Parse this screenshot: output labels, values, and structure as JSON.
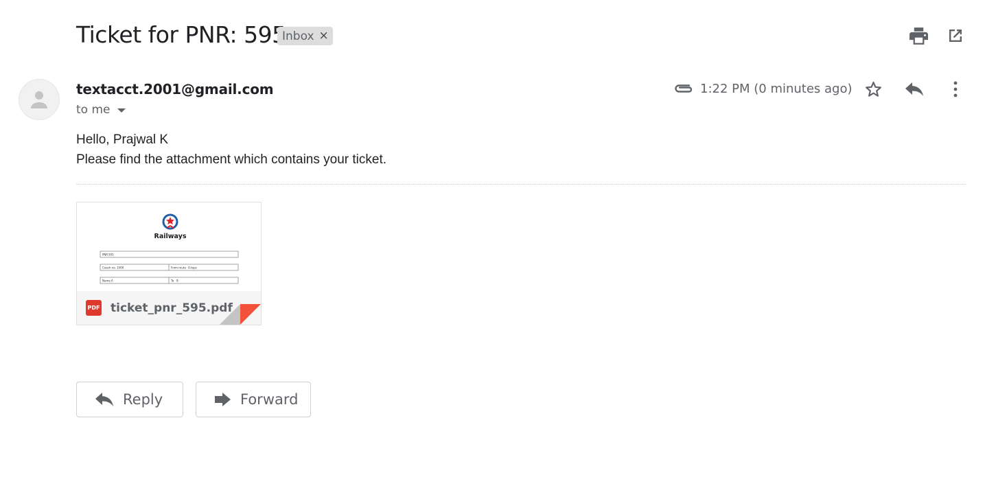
{
  "email": {
    "subject": "Ticket for PNR: 595",
    "label": "Inbox",
    "label_remove": "×",
    "sender": "textacct.2001@gmail.com",
    "recipient": "to me",
    "time": "1:22 PM (0 minutes ago)",
    "body": {
      "greeting": "Hello, Prajwal K",
      "message": "Please find the attachment which contains your ticket."
    }
  },
  "attachment": {
    "filename": "ticket_pnr_595.pdf",
    "badge": "PDF",
    "preview": {
      "logo_text": "Railways",
      "rows": [
        [
          "PNR",
          "595"
        ],
        [
          "Coach no.",
          "1000",
          "From-route",
          "A-tops"
        ],
        [
          "Name",
          "A",
          "To",
          "B"
        ]
      ]
    }
  },
  "actions": {
    "reply": "Reply",
    "forward": "Forward"
  },
  "icons": [
    "print-icon",
    "open-in-new-icon",
    "avatar-person-icon",
    "attachment-clip-icon",
    "star-icon",
    "reply-icon",
    "more-vert-icon",
    "caret-down-icon",
    "pdf-icon",
    "forward-icon"
  ],
  "colors": {
    "pdf_red": "#dd3a2d",
    "corner_red": "#f4513a",
    "chip_bg": "#dddddd",
    "text_gray": "#5f6368"
  }
}
